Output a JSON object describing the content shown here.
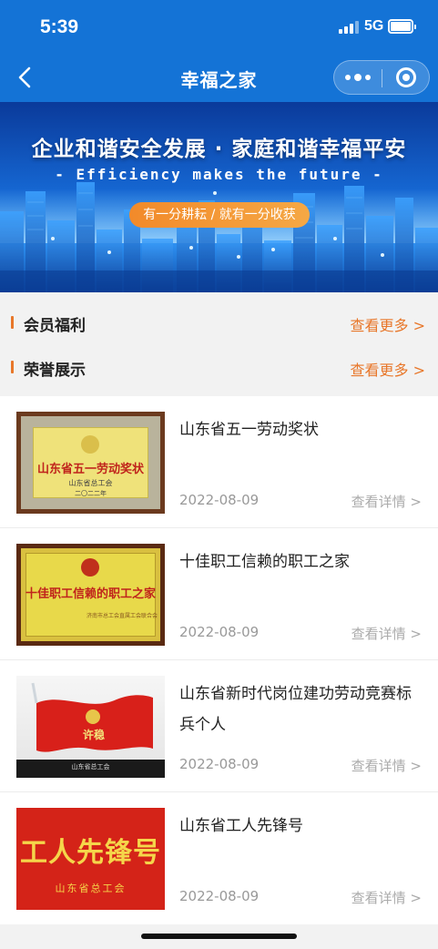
{
  "status": {
    "time": "5:39",
    "network": "5G"
  },
  "nav": {
    "title": "幸福之家"
  },
  "banner": {
    "title": "企业和谐安全发展 · 家庭和谐幸福平安",
    "subtitle": "- Efficiency makes the future -",
    "pill": "有一分耕耘 / 就有一分收获"
  },
  "sections": [
    {
      "title": "会员福利",
      "more": "查看更多 >"
    },
    {
      "title": "荣誉展示",
      "more": "查看更多 >"
    }
  ],
  "items": [
    {
      "title": "山东省五一劳动奖状",
      "date": "2022-08-09",
      "more": "查看详情 >",
      "plaque_text": "山东省五一劳动奖状",
      "plaque_org": "山东省总工会",
      "plaque_year": "二〇二二年"
    },
    {
      "title": "十佳职工信赖的职工之家",
      "date": "2022-08-09",
      "more": "查看详情 >",
      "plaque_text": "十佳职工信赖的职工之家",
      "plaque_org": "济南市总工会直属工会联合会"
    },
    {
      "title": "山东省新时代岗位建功劳动竞赛标兵个人",
      "date": "2022-08-09",
      "more": "查看详情 >",
      "plaque_text": "许稳",
      "plaque_org": "山东省总工会"
    },
    {
      "title": "山东省工人先锋号",
      "date": "2022-08-09",
      "more": "查看详情 >",
      "plaque_text": "工人先锋号",
      "plaque_org": "山东省总工会"
    }
  ],
  "colors": {
    "nav_blue": "#1473d6",
    "accent_orange": "#e8772a"
  }
}
